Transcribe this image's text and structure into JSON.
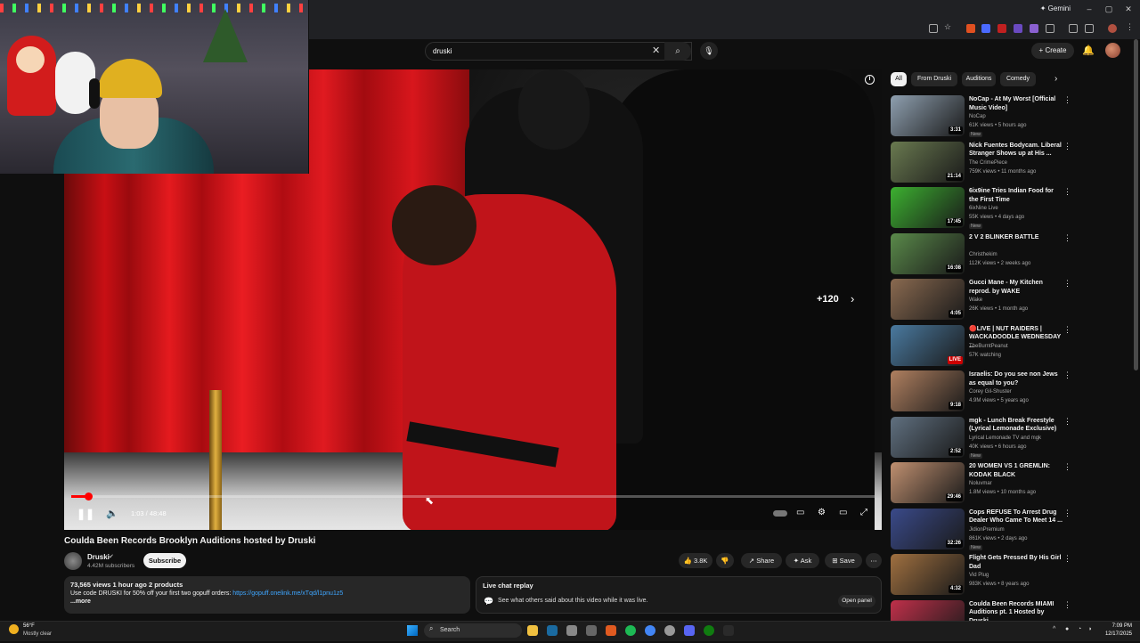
{
  "browser": {
    "gemini_label": "✦ Gemini"
  },
  "youtube": {
    "search_value": "druski",
    "create_label": "Create"
  },
  "player": {
    "skip_label": "+120",
    "time": "1:03 / 48:48",
    "progress": 0.0215
  },
  "video": {
    "title": "Coulda Been Records Brooklyn Auditions hosted by Druski",
    "channel": "Druski",
    "subscribers": "4.42M subscribers",
    "subscribe_label": "Subscribe",
    "likes": "3.8K",
    "share_label": "Share",
    "ask_label": "Ask",
    "save_label": "Save",
    "desc_meta": "73,565 views  1 hour ago  2 products",
    "desc_text": "Use code DRUSKI for 50% off your first two gopuff orders: ",
    "desc_link": "https://gopuff.onelink.me/xTqd/l1pnu1z5",
    "desc_more": "...more"
  },
  "livechat": {
    "title": "Live chat replay",
    "text": "See what others said about this video while it was live.",
    "open_label": "Open panel"
  },
  "chips": [
    "All",
    "From Druski",
    "Auditions",
    "Comedy"
  ],
  "recommendations": [
    {
      "title": "NoCap - At My Worst [Official Music Video]",
      "channel": "NoCap",
      "meta": "61K views • 5 hours ago",
      "badge": "New",
      "duration": "3:31",
      "color": "#8fa0b0"
    },
    {
      "title": "Nick Fuentes Bodycam. Liberal Stranger Shows up at His ...",
      "channel": "The CrimePiece",
      "meta": "759K views • 11 months ago",
      "badge": "",
      "duration": "21:14",
      "color": "#6a7a50"
    },
    {
      "title": "6ix9ine Tries Indian Food for the First Time",
      "channel": "6ixNine Live",
      "meta": "55K views • 4 days ago",
      "badge": "New",
      "duration": "17:45",
      "color": "#3cb030"
    },
    {
      "title": "2 V 2 BLINKER BATTLE",
      "channel": "Christhekim",
      "meta": "112K views • 2 weeks ago",
      "badge": "",
      "duration": "16:08",
      "color": "#5a8a4a"
    },
    {
      "title": "Gucci Mane - My Kitchen reprod. by WAKE",
      "channel": "Wake",
      "meta": "26K views • 1 month ago",
      "badge": "",
      "duration": "4:05",
      "color": "#8a6a50"
    },
    {
      "title": "🔴LIVE | NUT RAIDERS | WACKADOODLE WEDNESDAY ...",
      "channel": "TheBurntPeanut",
      "meta": "57K watching",
      "badge": "",
      "duration": "LIVE",
      "color": "#4a7aa0"
    },
    {
      "title": "Israelis: Do you see non Jews as equal to you?",
      "channel": "Corey Gil-Shuster",
      "meta": "4.9M views • 5 years ago",
      "badge": "",
      "duration": "9:18",
      "color": "#b08060"
    },
    {
      "title": "mgk - Lunch Break Freestyle (Lyrical Lemonade Exclusive)",
      "channel": "Lyrical Lemonade TV and mgk",
      "meta": "40K views • 6 hours ago",
      "badge": "New",
      "duration": "2:52",
      "color": "#607080"
    },
    {
      "title": "20 WOMEN VS 1 GREMLIN: KODAK BLACK",
      "channel": "Noluvmar",
      "meta": "1.8M views • 10 months ago",
      "badge": "",
      "duration": "29:46",
      "color": "#c09070"
    },
    {
      "title": "Cops REFUSE To Arrest Drug Dealer Who Came To Meet 14 ...",
      "channel": "JidionPremium",
      "meta": "861K views • 2 days ago",
      "badge": "New",
      "duration": "32:26",
      "color": "#3a4a8a"
    },
    {
      "title": "Flight Gets Pressed By His Girl Dad",
      "channel": "Vid Plug",
      "meta": "983K views • 8 years ago",
      "badge": "",
      "duration": "4:32",
      "color": "#a07040"
    },
    {
      "title": "Coulda Been Records MIAMI Auditions pt. 1 Hosted by Druski",
      "channel": "",
      "meta": "",
      "badge": "",
      "duration": "",
      "color": "#c0304a"
    }
  ],
  "taskbar": {
    "temp": "56°F",
    "weather": "Mostly clear",
    "search_label": "Search",
    "time": "7:09 PM",
    "date": "12/17/2025"
  }
}
